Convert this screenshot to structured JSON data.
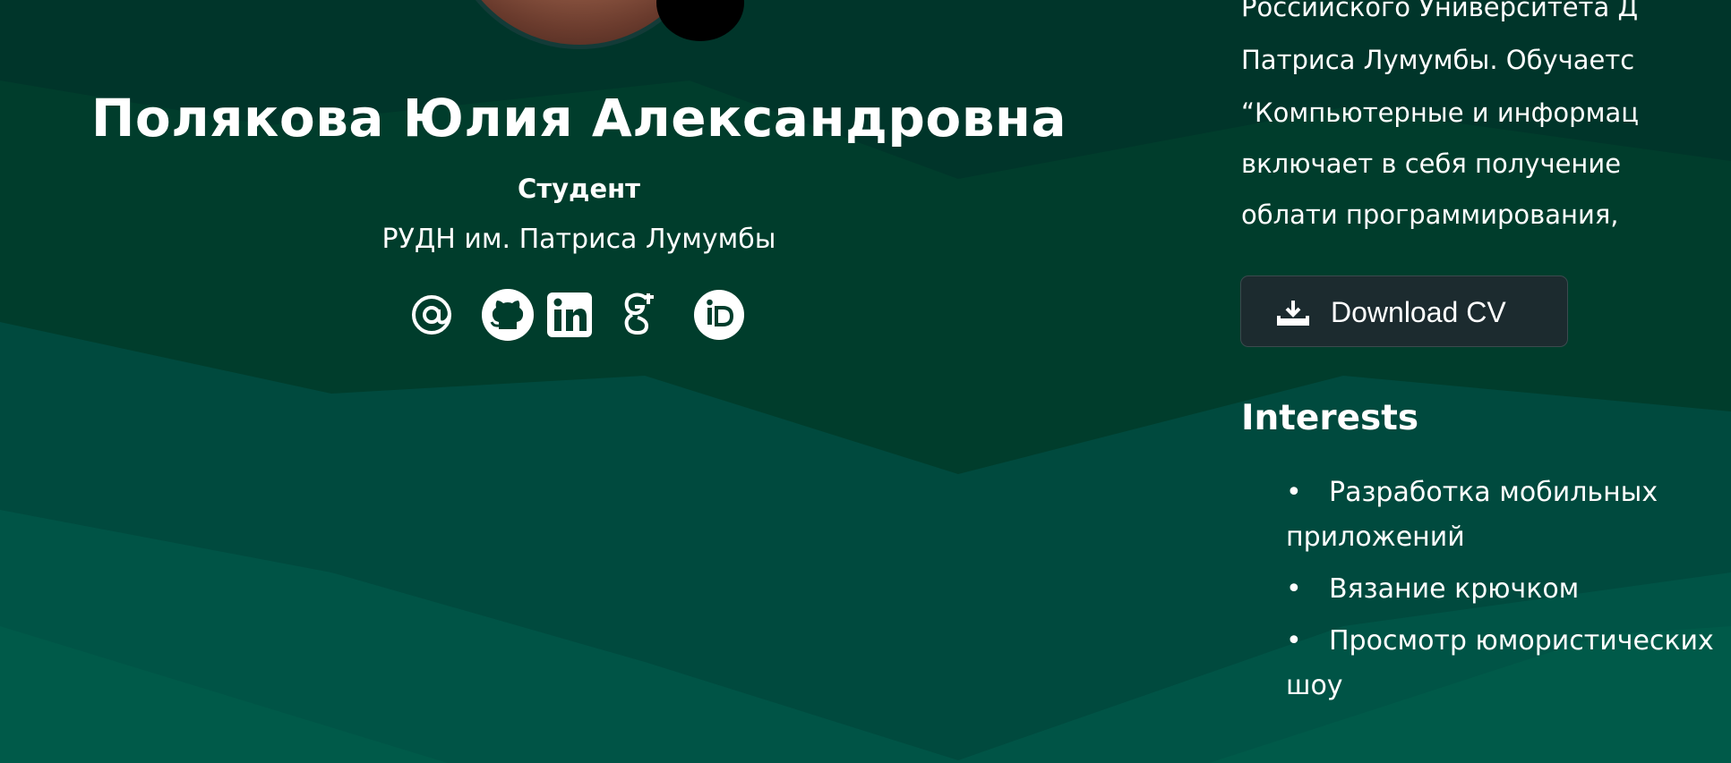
{
  "profile": {
    "name": "Полякова Юлия Александровна",
    "role": "Студент",
    "organization": "РУДН им. Патриса Лумумбы",
    "avatar_dot_color": "#000000",
    "socials": [
      {
        "name": "email",
        "icon": "at-sign-icon"
      },
      {
        "name": "github",
        "icon": "github-icon"
      },
      {
        "name": "linkedin",
        "icon": "linkedin-icon"
      },
      {
        "name": "google-scholar",
        "icon": "google-scholar-icon"
      },
      {
        "name": "orcid",
        "icon": "orcid-icon"
      }
    ]
  },
  "bio": {
    "lines": [
      "Российского Университета Д",
      "Патриса Лумумбы. Обучаетс",
      "“Компьютерные и информац",
      "включает в себя получение",
      "облати программирования, "
    ]
  },
  "download": {
    "label": "Download CV",
    "icon": "download-icon"
  },
  "interests": {
    "title": "Interests",
    "items": [
      "Разработка мобильных приложений",
      "Вязание крючком",
      "Просмотр юмористических шоу"
    ]
  },
  "colors": {
    "background_dark": "#003d2c",
    "background_mid": "#004a3c",
    "background_light": "#005a48",
    "button_bg": "#1c2b2f"
  }
}
